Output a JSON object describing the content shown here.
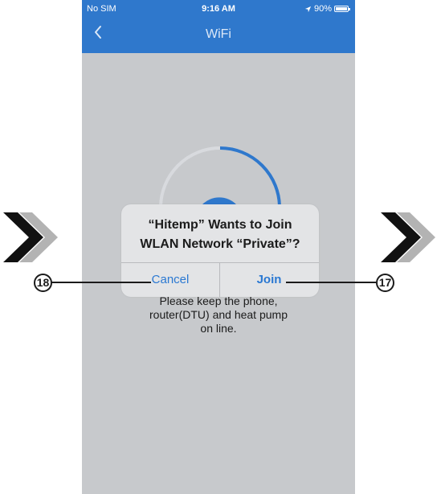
{
  "status_bar": {
    "carrier": "No SIM",
    "time": "9:16 AM",
    "battery": "90%"
  },
  "nav": {
    "title": "WiFi"
  },
  "dialog": {
    "message_line1": "“Hitemp” Wants to Join",
    "message_line2": "WLAN Network “Private”?",
    "cancel_label": "Cancel",
    "join_label": "Join"
  },
  "instruction": {
    "line1": "Please keep the phone,",
    "line2": "router(DTU) and heat pump",
    "line3": "on line."
  },
  "callouts": {
    "left": "18",
    "right": "17"
  },
  "colors": {
    "header_blue": "#2f78cc",
    "link_blue": "#2a78d2",
    "overlay_gray": "#c7c9cc",
    "dialog_bg": "#e3e4e6",
    "chevron_black": "#111111",
    "chevron_gray": "#b3b3b3"
  },
  "icons": {
    "back": "chevron-left-icon",
    "location": "location-arrow-icon",
    "battery": "battery-icon",
    "decor": "double-chevron-icon"
  }
}
